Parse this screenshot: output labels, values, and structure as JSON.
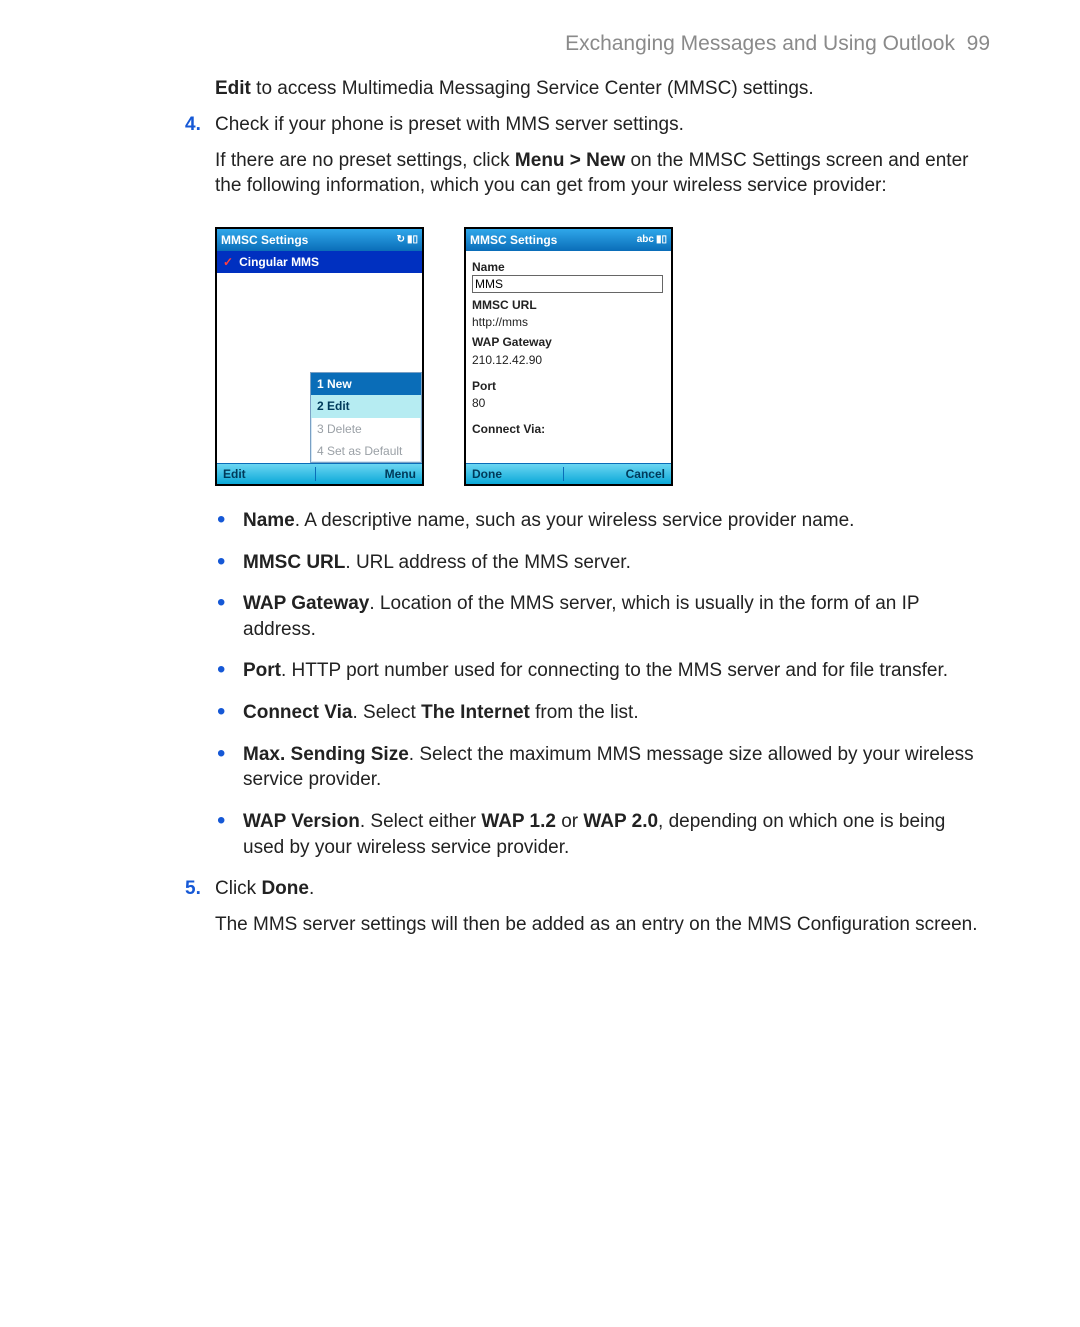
{
  "header": {
    "title": "Exchanging Messages and Using Outlook",
    "page": "99"
  },
  "intro": {
    "boldEdit": "Edit",
    "rest": " to access Multimedia Messaging Service Center (MMSC) settings."
  },
  "step4": {
    "num": "4.",
    "line1": "Check if your phone is preset with MMS server settings.",
    "line2a": "If there are no preset settings, click ",
    "line2b": "Menu > New",
    "line2c": " on the MMSC Settings screen and enter the following information, which you can get from your wireless service provider:"
  },
  "phoneLeft": {
    "title": "MMSC Settings",
    "row": "Cingular MMS",
    "menu": {
      "i1": "1 New",
      "i2": "2 Edit",
      "i3": "3 Delete",
      "i4": "4 Set as Default"
    },
    "softLeft": "Edit",
    "softRight": "Menu"
  },
  "phoneRight": {
    "title": "MMSC Settings",
    "indicator": "abc",
    "name_l": "Name",
    "name_v": "MMS",
    "url_l": "MMSC URL",
    "url_v": "http://mms",
    "wap_l": "WAP Gateway",
    "wap_v": "210.12.42.90",
    "port_l": "Port",
    "port_v": "80",
    "conn_l": "Connect Via:",
    "softLeft": "Done",
    "softRight": "Cancel"
  },
  "bullets": {
    "name_b": "Name",
    "name_t": ". A descriptive name, such as your wireless service provider name.",
    "url_b": "MMSC URL",
    "url_t": ". URL address of the MMS server.",
    "wap_b": "WAP Gateway",
    "wap_t": ". Location of the MMS server, which is usually in the form of an IP address.",
    "port_b": "Port",
    "port_t": ". HTTP port number used for connecting to the MMS server and for file transfer.",
    "conn_b": "Connect Via",
    "conn_t1": ". Select ",
    "conn_t2": "The Internet",
    "conn_t3": " from the list.",
    "max_b": "Max. Sending Size",
    "max_t": ". Select the maximum MMS message size allowed by your wireless service provider.",
    "ver_b": "WAP Version",
    "ver_t1": ". Select either ",
    "ver_t2": "WAP 1.2",
    "ver_t3": " or ",
    "ver_t4": "WAP 2.0",
    "ver_t5": ", depending on which one is being used by your wireless service provider."
  },
  "step5": {
    "num": "5.",
    "line1a": "Click ",
    "line1b": "Done",
    "line1c": ".",
    "line2": "The MMS server settings will then be added as an entry on the MMS Configuration screen."
  }
}
